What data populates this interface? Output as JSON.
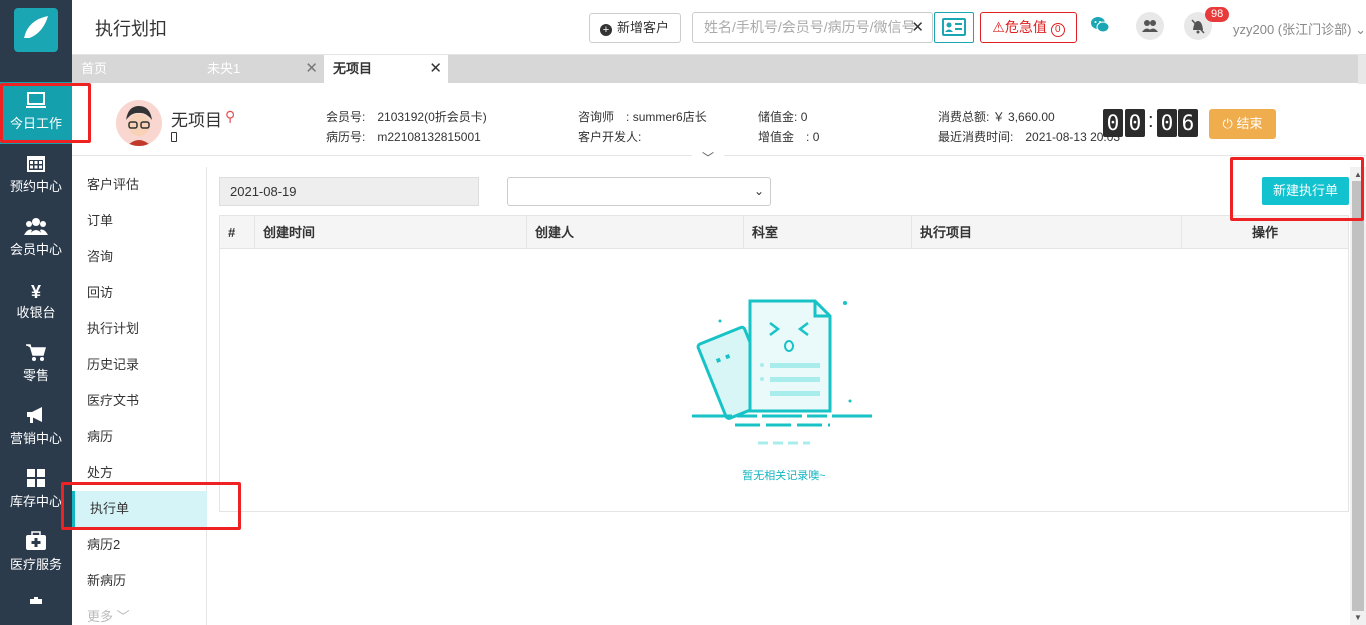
{
  "app": {
    "page_title": "执行划扣"
  },
  "rail": {
    "items": [
      {
        "label": "今日工作",
        "icon": "monitor-icon"
      },
      {
        "label": "预约中心",
        "icon": "calendar-icon"
      },
      {
        "label": "会员中心",
        "icon": "users-icon"
      },
      {
        "label": "收银台",
        "icon": "yen-icon"
      },
      {
        "label": "零售",
        "icon": "cart-icon"
      },
      {
        "label": "营销中心",
        "icon": "megaphone-icon"
      },
      {
        "label": "库存中心",
        "icon": "grid-icon"
      },
      {
        "label": "医疗服务",
        "icon": "medkit-icon"
      }
    ]
  },
  "topbar": {
    "new_customer_label": "新增客户",
    "search_placeholder": "姓名/手机号/会员号/病历号/微信号",
    "search_clear": "✕",
    "danger_label": "危急值",
    "danger_count": "0",
    "notification_count": "98",
    "user_label": "yzy200 (张江门诊部)"
  },
  "tabs": [
    {
      "label": "首页"
    },
    {
      "label": "未央1"
    },
    {
      "label": "无项目"
    }
  ],
  "patient": {
    "name": "无项目",
    "member_no_label": "会员号:",
    "member_no": "2103192(0折会员卡)",
    "record_no_label": "病历号:",
    "record_no": "m22108132815001",
    "consultant_label": "咨询师　:",
    "consultant": "summer6店长",
    "developer_label": "客户开发人:",
    "developer": "",
    "stored_label": "储值金:",
    "stored": "0",
    "bonus_label": "增值金　:",
    "bonus": "0",
    "total_label": "消费总额:",
    "total": "￥ 3,660.00",
    "last_label": "最近消费时间:",
    "last": "2021-08-13 20:03",
    "timer": [
      "0",
      "0",
      "0",
      "6"
    ],
    "end_label": "结束"
  },
  "subnav": {
    "items": [
      {
        "label": "客户评估"
      },
      {
        "label": "订单"
      },
      {
        "label": "咨询"
      },
      {
        "label": "回访"
      },
      {
        "label": "执行计划"
      },
      {
        "label": "历史记录"
      },
      {
        "label": "医疗文书"
      },
      {
        "label": "病历"
      },
      {
        "label": "处方"
      },
      {
        "label": "执行单"
      },
      {
        "label": "病历2"
      },
      {
        "label": "新病历"
      },
      {
        "label": "更多"
      }
    ]
  },
  "filters": {
    "date": "2021-08-19",
    "select_value": ""
  },
  "actions": {
    "new_exec_label": "新建执行单"
  },
  "table": {
    "headers": [
      "#",
      "创建时间",
      "创建人",
      "科室",
      "执行项目",
      "操作"
    ],
    "empty_text": "暂无相关记录噢~"
  },
  "colors": {
    "accent": "#12b5c1",
    "rail": "#2b3b4c",
    "danger": "#e02020",
    "end": "#f0ad4e",
    "highlight_box": "#e22222"
  }
}
